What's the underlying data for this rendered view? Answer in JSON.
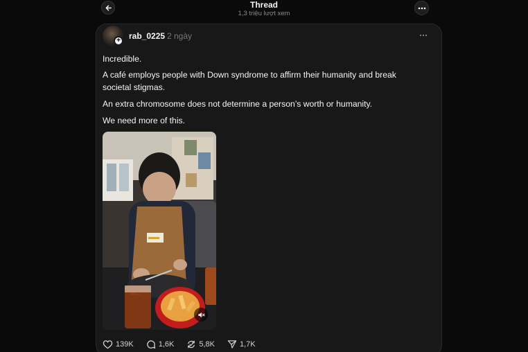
{
  "header": {
    "title": "Thread",
    "views": "1,3 triệu lượt xem"
  },
  "post": {
    "username": "rab_0225",
    "time": "2 ngày",
    "paragraphs": [
      "Incredible.",
      "A café employs people with Down syndrome to affirm their humanity and break societal stigmas.",
      "An extra chromosome does not determine a person’s worth or humanity.",
      "We need more of this."
    ],
    "media": {
      "type": "video",
      "muted": true
    },
    "stats": {
      "likes": "139K",
      "replies": "1,6K",
      "reposts": "5,8K",
      "shares": "1,7K"
    }
  },
  "colors": {
    "background": "#0a0a0a",
    "card": "#181818",
    "text": "#f3f5f7",
    "muted": "#777777"
  },
  "icons": [
    "back-arrow-icon",
    "more-icon",
    "plus-icon",
    "mute-icon",
    "heart-icon",
    "comment-icon",
    "repost-icon",
    "share-icon"
  ]
}
